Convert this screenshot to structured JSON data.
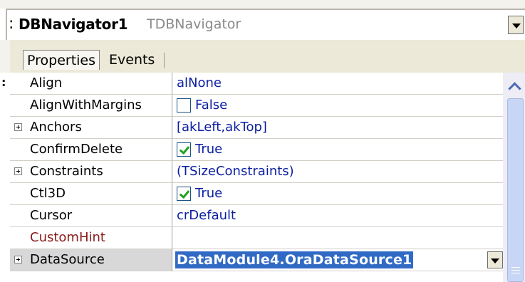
{
  "component": {
    "name": "DBNavigator1",
    "type": "TDBNavigator"
  },
  "tabs": [
    {
      "label": "Properties",
      "active": true
    },
    {
      "label": "Events",
      "active": false
    }
  ],
  "properties": [
    {
      "name": "Align",
      "value": "alNone",
      "expandable": false,
      "checkbox": null
    },
    {
      "name": "AlignWithMargins",
      "value": "False",
      "expandable": false,
      "checkbox": "unchecked"
    },
    {
      "name": "Anchors",
      "value": "[akLeft,akTop]",
      "expandable": true,
      "checkbox": null
    },
    {
      "name": "ConfirmDelete",
      "value": "True",
      "expandable": false,
      "checkbox": "checked"
    },
    {
      "name": "Constraints",
      "value": "(TSizeConstraints)",
      "expandable": true,
      "checkbox": null
    },
    {
      "name": "Ctl3D",
      "value": "True",
      "expandable": false,
      "checkbox": "checked"
    },
    {
      "name": "Cursor",
      "value": "crDefault",
      "expandable": false,
      "checkbox": null
    },
    {
      "name": "CustomHint",
      "value": "",
      "expandable": false,
      "checkbox": null
    },
    {
      "name": "DataSource",
      "value": "DataModule4.OraDataSource1",
      "expandable": true,
      "checkbox": null,
      "selected": true
    }
  ],
  "colors": {
    "value_text": "#0a1ea0",
    "selection": "#316ac5",
    "custom_hint": "#8b1a1a",
    "check_mark": "#21a121"
  }
}
